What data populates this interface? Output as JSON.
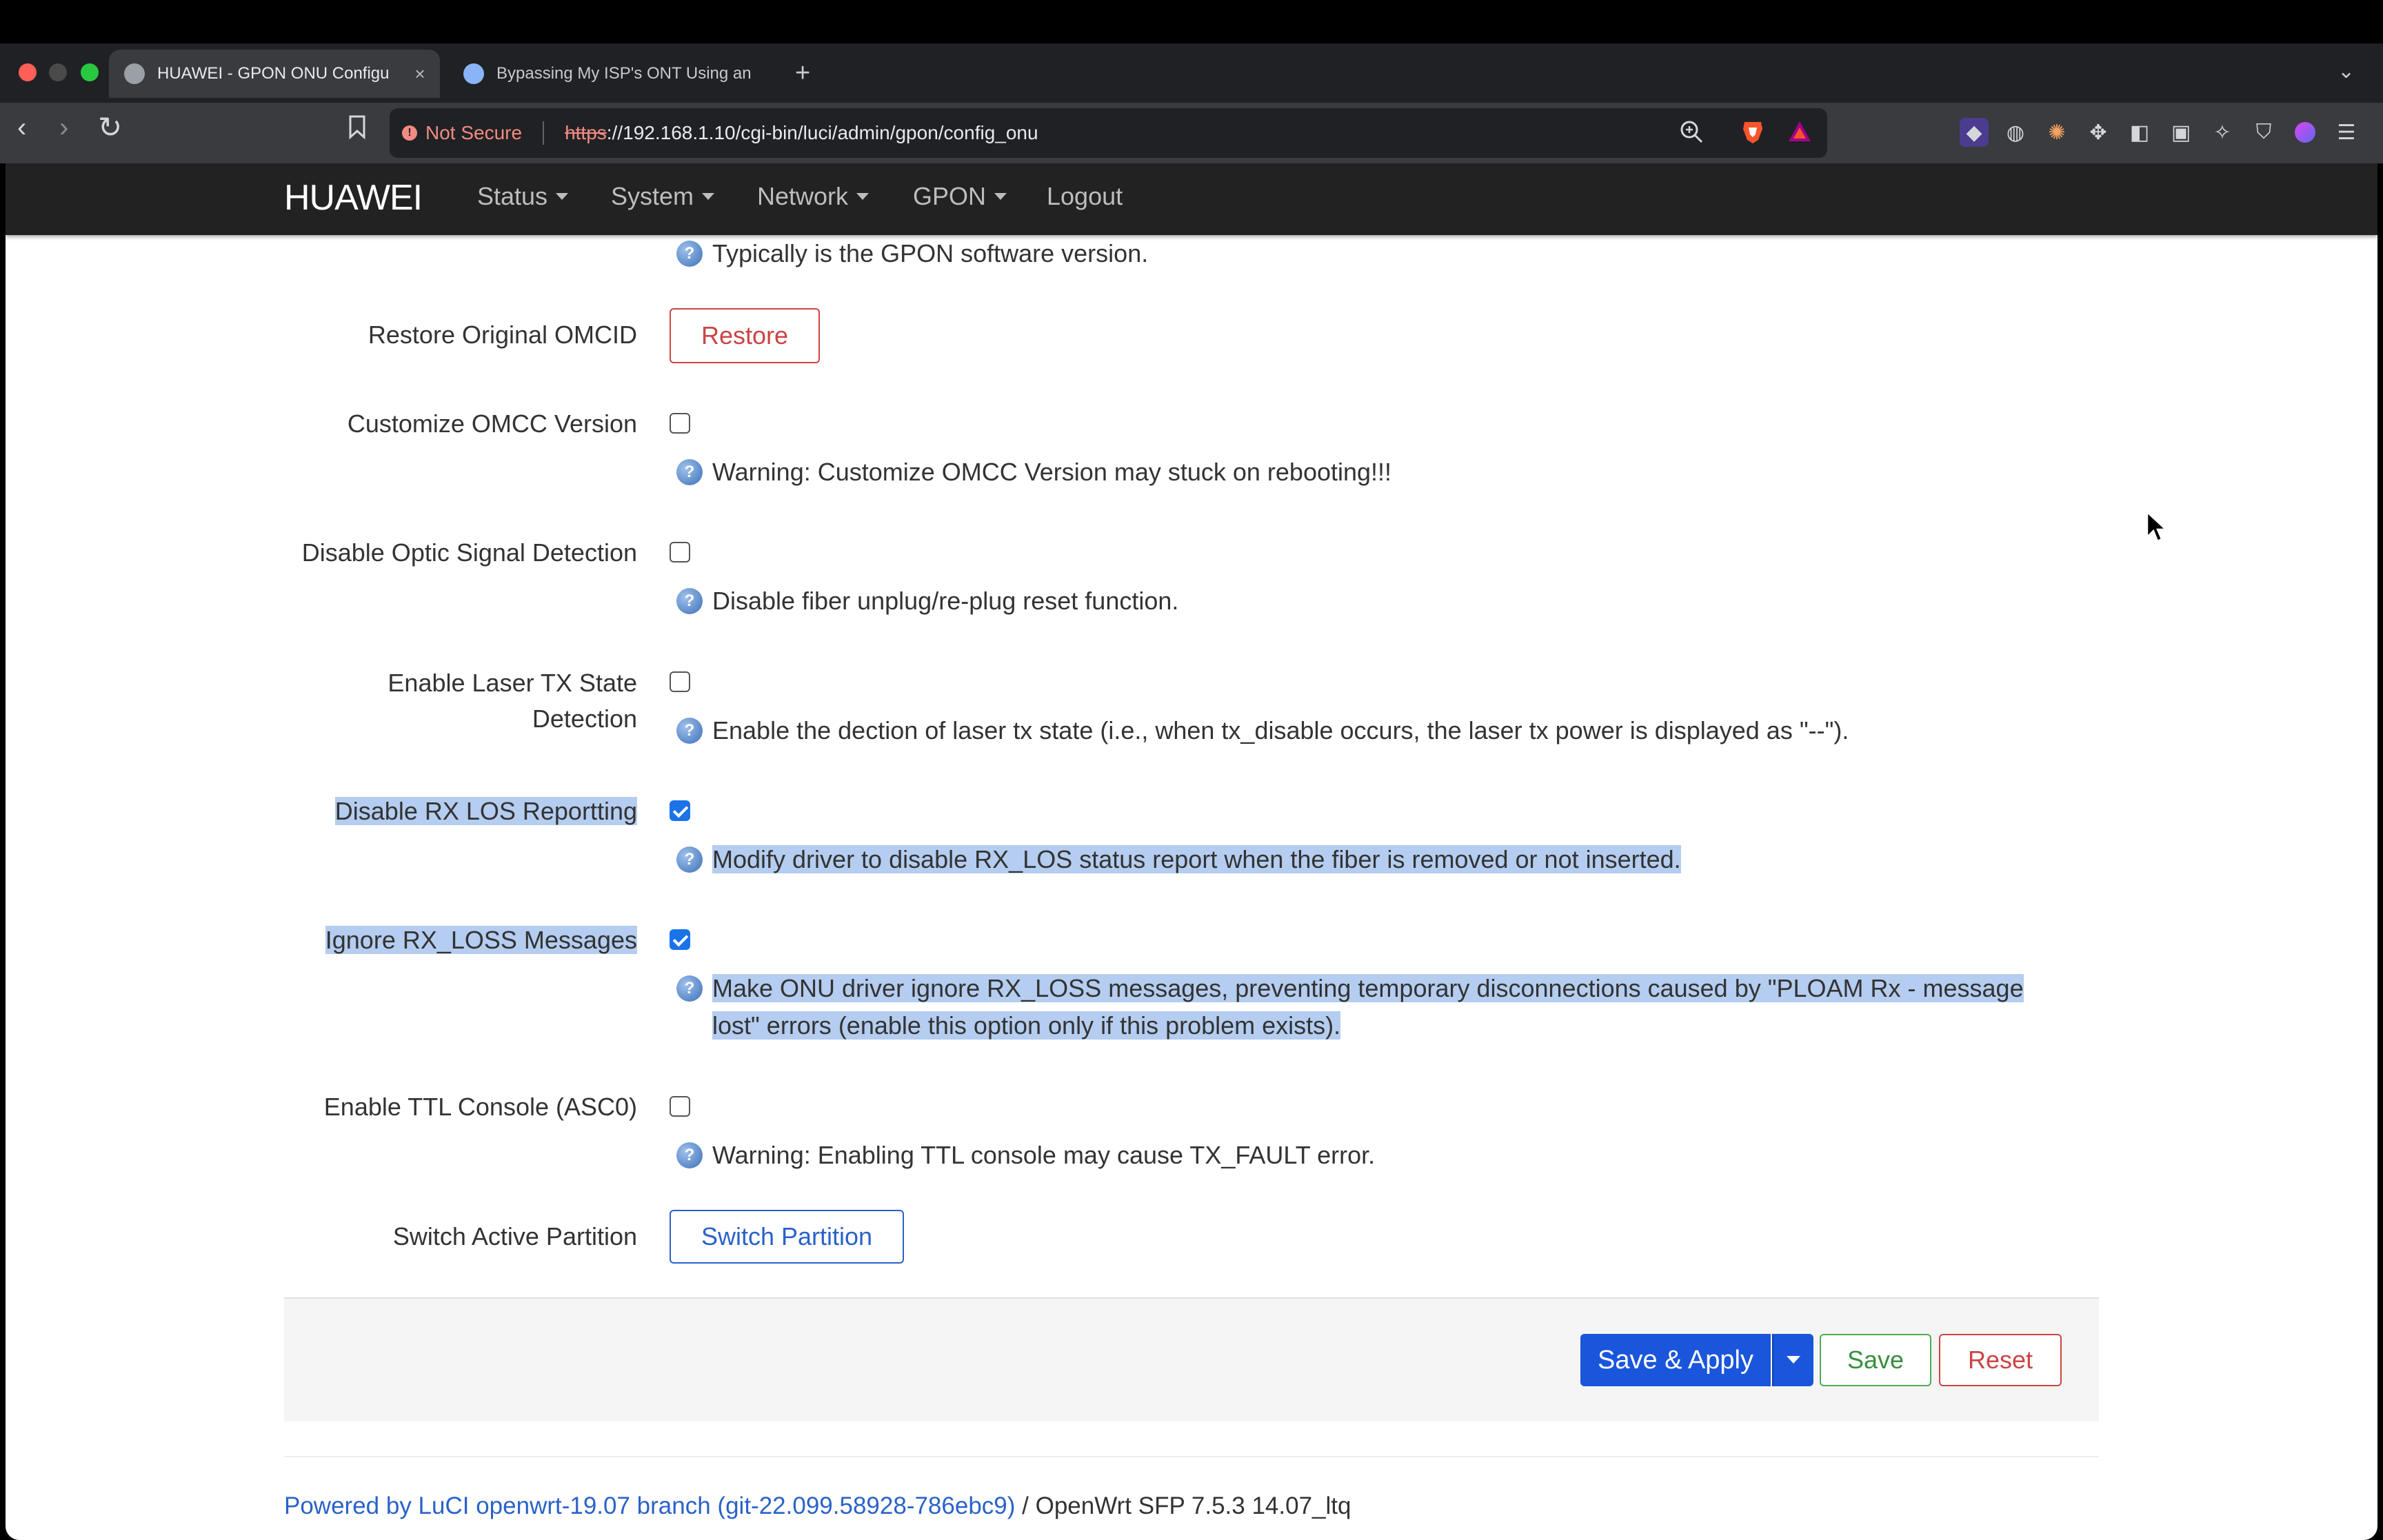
{
  "browser": {
    "tabs": [
      {
        "title": "HUAWEI - GPON ONU Configu",
        "active": true
      },
      {
        "title": "Bypassing My ISP's ONT Using an",
        "active": false
      }
    ],
    "new_tab": "+",
    "url_security": "Not Secure",
    "url_scheme": "https",
    "url_rest": "://192.168.1.10/cgi-bin/luci/admin/gpon/config_onu"
  },
  "header": {
    "brand": "HUAWEI",
    "menu": [
      "Status",
      "System",
      "Network",
      "GPON",
      "Logout"
    ]
  },
  "form": {
    "top_note": "Typically is the GPON software version.",
    "restore": {
      "label": "Restore Original OMCID",
      "button": "Restore"
    },
    "omcc": {
      "label": "Customize OMCC Version",
      "checked": false,
      "note": "Warning: Customize OMCC Version may stuck on rebooting!!!"
    },
    "optic": {
      "label": "Disable Optic Signal Detection",
      "checked": false,
      "note": "Disable fiber unplug/re-plug reset function."
    },
    "laser": {
      "label_line1": "Enable Laser TX State",
      "label_line2": "Detection",
      "checked": false,
      "note": "Enable the dection of laser tx state (i.e., when tx_disable occurs, the laser tx power is displayed as \"--\")."
    },
    "rxlos": {
      "label": "Disable RX LOS Reportting",
      "checked": true,
      "note": "Modify driver to disable RX_LOS status report when the fiber is removed or not inserted."
    },
    "rxloss": {
      "label": "Ignore RX_LOSS Messages",
      "checked": true,
      "note_line1": "Make ONU driver ignore RX_LOSS messages, preventing temporary disconnections caused by \"PLOAM Rx - message",
      "note_line2": "lost\" errors (enable this option only if this problem exists)."
    },
    "ttl": {
      "label": "Enable TTL Console (ASC0)",
      "checked": false,
      "note": "Warning: Enabling TTL console may cause TX_FAULT error."
    },
    "partition": {
      "label": "Switch Active Partition",
      "button": "Switch Partition"
    }
  },
  "actions": {
    "save_apply": "Save & Apply",
    "save": "Save",
    "reset": "Reset"
  },
  "footer": {
    "link": "Powered by LuCI openwrt-19.07 branch (git-22.099.58928-786ebc9)",
    "rest": " / OpenWrt SFP 7.5.3 14.07_ltq"
  },
  "colors": {
    "primary": "#1a56db",
    "danger": "#cc4444",
    "success": "#388e3c",
    "highlight": "#b4cdf0",
    "header": "#222222"
  }
}
